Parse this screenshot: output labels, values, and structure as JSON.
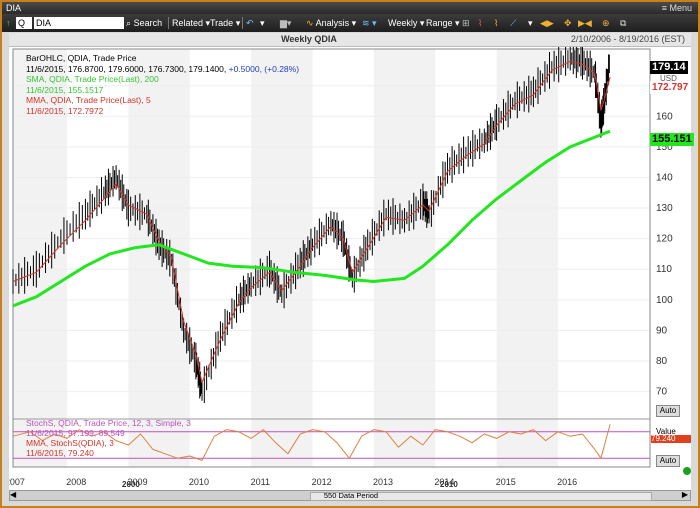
{
  "window": {
    "title": "DIA",
    "menu": "Menu"
  },
  "toolbar": {
    "symbol": "DIA",
    "search_label": "Search",
    "related_label": "Related",
    "trade_label": "Trade",
    "analysis_label": "Analysis",
    "weekly_label": "Weekly",
    "range_label": "Range"
  },
  "header": {
    "title": "Weekly QDIA",
    "range": "2/10/2006 - 8/19/2016 (EST)"
  },
  "legend": {
    "bar_title": "BarOHLC, QDIA, Trade Price",
    "bar_values": "11/6/2015, 176.8700, 179.6000, 176.7300, 179.1400,",
    "bar_change": "+0.5000, (+0.28%)",
    "sma_title": "SMA, QDIA, Trade Price(Last),  200",
    "sma_value": "11/6/2015, 155.1517",
    "mma_title": "MMA, QDIA, Trade Price(Last),  5",
    "mma_value": "11/6/2015, 172.7972"
  },
  "osc_legend": {
    "stoch_title": "StochS, QDIA, Trade Price,  12, 3, Simple, 3",
    "stoch_value": "11/6/2015, 97.199, 89.549",
    "mma_title": "MMA, StochS(QDIA),  3",
    "mma_value": "11/6/2015, 79.240"
  },
  "price_labels": {
    "last": "179.14",
    "mma": "172.797",
    "sma": "155.151"
  },
  "axis_extra": {
    "usd": "USD",
    "value": "Value",
    "osc_val": "79.240",
    "auto": "Auto"
  },
  "bottom": {
    "period": "550 Data Period",
    "year2000": "2000",
    "year2010": "2010"
  },
  "colors": {
    "price": "#000000",
    "sma": "#22e61e",
    "mma": "#d4352a",
    "stoch": "#c050c0",
    "stoch_mma": "#e08040"
  },
  "chart_data": {
    "type": "line",
    "x_ticks": [
      "2007",
      "2008",
      "2009",
      "2010",
      "2011",
      "2012",
      "2013",
      "2014",
      "2015",
      "2016"
    ],
    "y_ticks": [
      70,
      80,
      90,
      100,
      110,
      120,
      130,
      140,
      150,
      160,
      170
    ],
    "ylim": [
      63,
      182
    ],
    "price": [
      [
        2006.12,
        106
      ],
      [
        2006.5,
        110
      ],
      [
        2006.9,
        120
      ],
      [
        2007.3,
        128
      ],
      [
        2007.6,
        135
      ],
      [
        2007.8,
        140
      ],
      [
        2008.0,
        130
      ],
      [
        2008.3,
        128
      ],
      [
        2008.5,
        118
      ],
      [
        2008.7,
        113
      ],
      [
        2008.9,
        90
      ],
      [
        2009.1,
        80
      ],
      [
        2009.2,
        70
      ],
      [
        2009.5,
        88
      ],
      [
        2009.8,
        100
      ],
      [
        2010.0,
        105
      ],
      [
        2010.3,
        110
      ],
      [
        2010.5,
        102
      ],
      [
        2010.8,
        112
      ],
      [
        2011.0,
        118
      ],
      [
        2011.3,
        125
      ],
      [
        2011.5,
        120
      ],
      [
        2011.65,
        107
      ],
      [
        2011.9,
        118
      ],
      [
        2012.2,
        128
      ],
      [
        2012.5,
        126
      ],
      [
        2012.8,
        132
      ],
      [
        2012.9,
        128
      ],
      [
        2013.2,
        143
      ],
      [
        2013.5,
        148
      ],
      [
        2013.8,
        152
      ],
      [
        2014.0,
        158
      ],
      [
        2014.3,
        165
      ],
      [
        2014.6,
        168
      ],
      [
        2014.9,
        176
      ],
      [
        2015.2,
        179
      ],
      [
        2015.4,
        178
      ],
      [
        2015.6,
        174
      ],
      [
        2015.7,
        158
      ],
      [
        2015.75,
        164
      ],
      [
        2015.85,
        179
      ]
    ],
    "mma": [
      [
        2006.12,
        106
      ],
      [
        2006.5,
        109
      ],
      [
        2006.9,
        118
      ],
      [
        2007.3,
        126
      ],
      [
        2007.6,
        133
      ],
      [
        2007.8,
        138
      ],
      [
        2008.0,
        131
      ],
      [
        2008.3,
        128
      ],
      [
        2008.5,
        119
      ],
      [
        2008.7,
        114
      ],
      [
        2008.9,
        93
      ],
      [
        2009.1,
        82
      ],
      [
        2009.2,
        73
      ],
      [
        2009.5,
        87
      ],
      [
        2009.8,
        99
      ],
      [
        2010.0,
        104
      ],
      [
        2010.3,
        109
      ],
      [
        2010.5,
        103
      ],
      [
        2010.8,
        111
      ],
      [
        2011.0,
        117
      ],
      [
        2011.3,
        124
      ],
      [
        2011.5,
        120
      ],
      [
        2011.65,
        109
      ],
      [
        2011.9,
        117
      ],
      [
        2012.2,
        127
      ],
      [
        2012.5,
        126
      ],
      [
        2012.8,
        131
      ],
      [
        2012.9,
        129
      ],
      [
        2013.2,
        142
      ],
      [
        2013.5,
        147
      ],
      [
        2013.8,
        151
      ],
      [
        2014.0,
        157
      ],
      [
        2014.3,
        164
      ],
      [
        2014.6,
        167
      ],
      [
        2014.9,
        175
      ],
      [
        2015.2,
        178
      ],
      [
        2015.4,
        177
      ],
      [
        2015.6,
        174
      ],
      [
        2015.7,
        162
      ],
      [
        2015.75,
        165
      ],
      [
        2015.85,
        172.8
      ]
    ],
    "sma": [
      [
        2006.12,
        98
      ],
      [
        2006.5,
        101
      ],
      [
        2006.9,
        106
      ],
      [
        2007.3,
        111
      ],
      [
        2007.7,
        115
      ],
      [
        2008.1,
        117
      ],
      [
        2008.5,
        118
      ],
      [
        2008.9,
        115
      ],
      [
        2009.3,
        112
      ],
      [
        2009.7,
        111
      ],
      [
        2010.2,
        110.5
      ],
      [
        2010.7,
        109
      ],
      [
        2011.2,
        108
      ],
      [
        2011.7,
        106.5
      ],
      [
        2012.0,
        106
      ],
      [
        2012.5,
        107
      ],
      [
        2012.8,
        111
      ],
      [
        2013.2,
        118
      ],
      [
        2013.6,
        126
      ],
      [
        2014.0,
        133
      ],
      [
        2014.4,
        139
      ],
      [
        2014.8,
        145
      ],
      [
        2015.2,
        150
      ],
      [
        2015.85,
        155.15
      ]
    ],
    "stoch": [
      [
        2006.12,
        70
      ],
      [
        2006.4,
        80
      ],
      [
        2006.6,
        60
      ],
      [
        2006.8,
        75
      ],
      [
        2007.0,
        65
      ],
      [
        2007.2,
        85
      ],
      [
        2007.4,
        70
      ],
      [
        2007.6,
        80
      ],
      [
        2007.8,
        60
      ],
      [
        2008.0,
        50
      ],
      [
        2008.2,
        75
      ],
      [
        2008.4,
        40
      ],
      [
        2008.6,
        30
      ],
      [
        2008.8,
        20
      ],
      [
        2009.0,
        25
      ],
      [
        2009.2,
        15
      ],
      [
        2009.4,
        70
      ],
      [
        2009.6,
        85
      ],
      [
        2009.8,
        80
      ],
      [
        2010.0,
        65
      ],
      [
        2010.2,
        85
      ],
      [
        2010.4,
        55
      ],
      [
        2010.6,
        30
      ],
      [
        2010.8,
        75
      ],
      [
        2011.0,
        85
      ],
      [
        2011.2,
        80
      ],
      [
        2011.4,
        55
      ],
      [
        2011.6,
        20
      ],
      [
        2011.8,
        70
      ],
      [
        2012.0,
        85
      ],
      [
        2012.2,
        80
      ],
      [
        2012.4,
        45
      ],
      [
        2012.6,
        70
      ],
      [
        2012.8,
        50
      ],
      [
        2013.0,
        85
      ],
      [
        2013.2,
        80
      ],
      [
        2013.4,
        70
      ],
      [
        2013.6,
        55
      ],
      [
        2013.8,
        75
      ],
      [
        2014.0,
        65
      ],
      [
        2014.2,
        80
      ],
      [
        2014.4,
        75
      ],
      [
        2014.6,
        85
      ],
      [
        2014.8,
        60
      ],
      [
        2015.0,
        80
      ],
      [
        2015.2,
        70
      ],
      [
        2015.4,
        75
      ],
      [
        2015.6,
        40
      ],
      [
        2015.7,
        20
      ],
      [
        2015.85,
        97.2
      ]
    ]
  }
}
